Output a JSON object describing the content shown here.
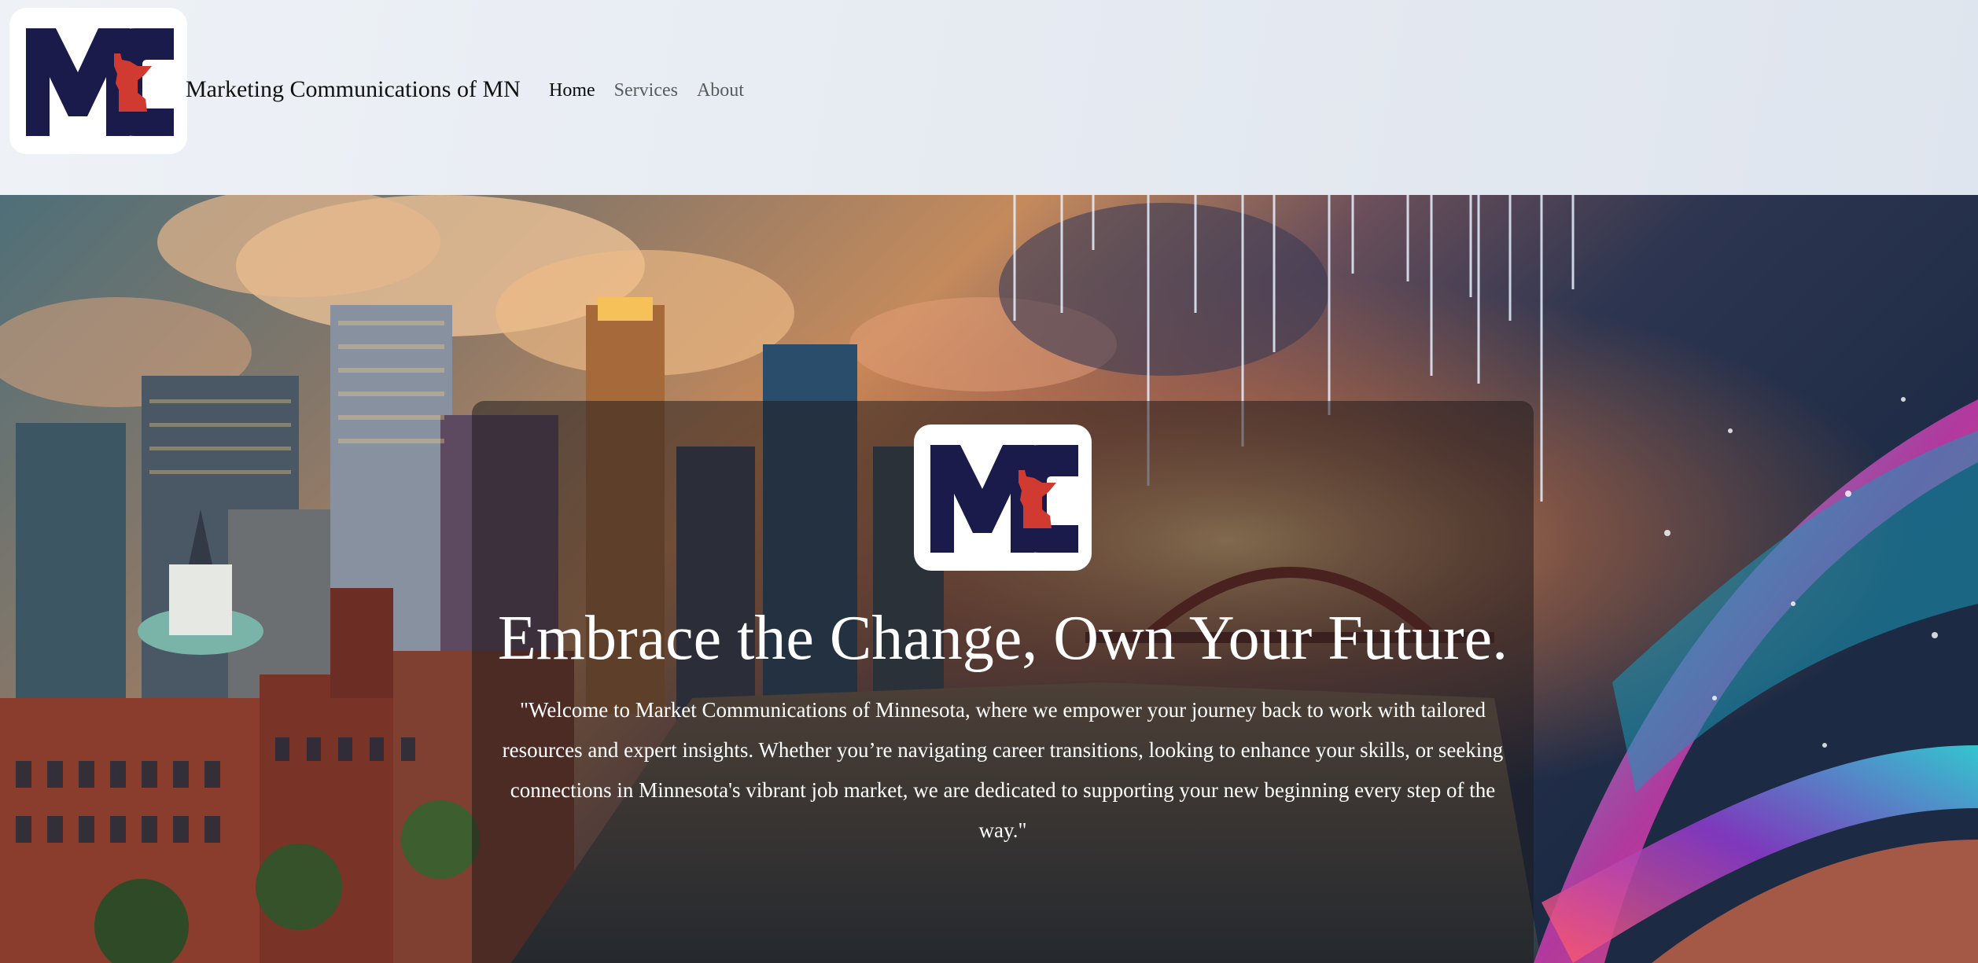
{
  "header": {
    "logo_name": "mc-minnesota-logo",
    "site_title": "Marketing Communications of MN",
    "nav": [
      {
        "label": "Home",
        "active": true
      },
      {
        "label": "Services",
        "active": false
      },
      {
        "label": "About",
        "active": false
      }
    ]
  },
  "hero": {
    "logo_name": "mc-minnesota-logo",
    "heading": "Embrace the Change, Own Your Future.",
    "text": "\"Welcome to Market Communications of Minnesota, where we empower your journey back to work with tailored resources and expert insights. Whether you’re navigating career transitions, looking to enhance your skills, or seeking connections in Minnesota's vibrant job market, we are dedicated to supporting your new beginning every step of the way.\""
  },
  "colors": {
    "brand_navy": "#1b1b4b",
    "brand_red": "#d13a30",
    "header_bg": "#e6ebf2",
    "nav_active": "#0b0b0b",
    "nav_inactive": "#5b5b5b"
  }
}
